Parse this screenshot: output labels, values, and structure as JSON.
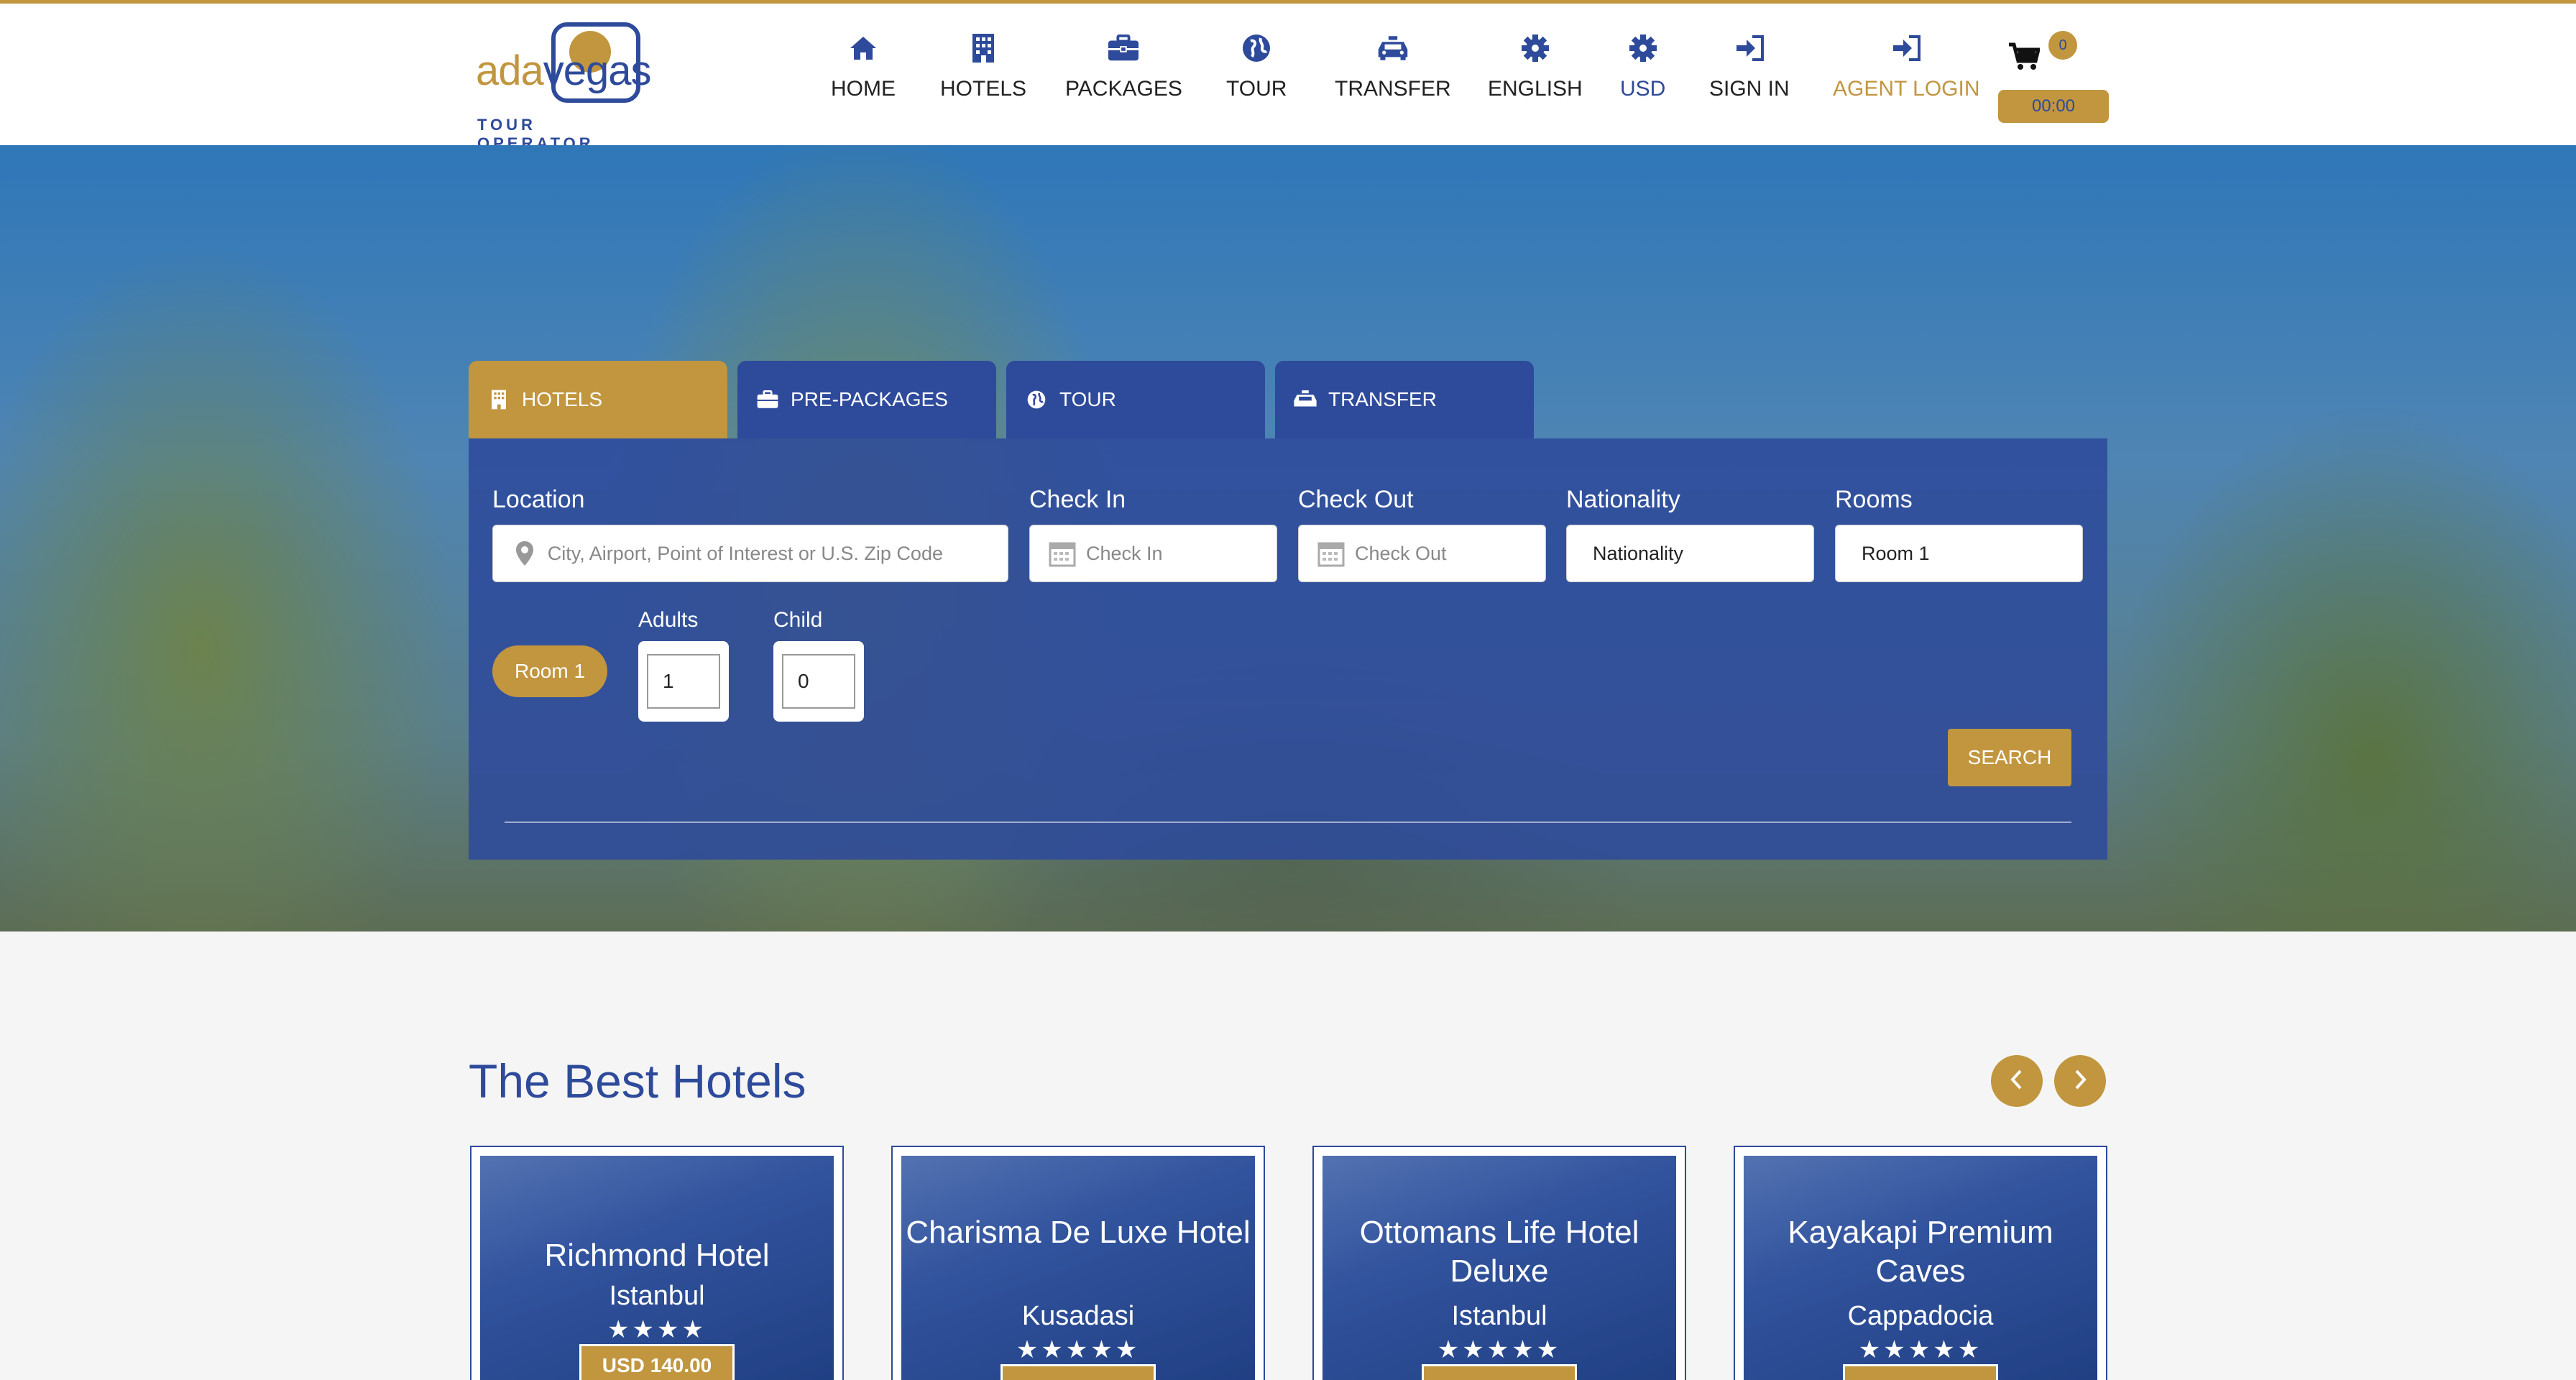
{
  "header": {
    "logo": {
      "word_left": "ada",
      "word_right": "vegas",
      "subtitle": "TOUR OPERATOR"
    },
    "nav": [
      {
        "label": "HOME",
        "icon": "home-icon"
      },
      {
        "label": "HOTELS",
        "icon": "building-icon"
      },
      {
        "label": "PACKAGES",
        "icon": "briefcase-icon"
      },
      {
        "label": "TOUR",
        "icon": "globe-icon"
      },
      {
        "label": "TRANSFER",
        "icon": "taxi-icon"
      },
      {
        "label": "ENGLISH",
        "icon": "gear-icon"
      },
      {
        "label": "USD",
        "icon": "gear-icon"
      },
      {
        "label": "SIGN IN",
        "icon": "sign-in-icon"
      },
      {
        "label": "AGENT LOGIN",
        "icon": "sign-in-icon"
      }
    ],
    "cart": {
      "count": "0",
      "timer": "00:00",
      "icon": "cart-icon"
    }
  },
  "search": {
    "tabs": [
      {
        "label": "HOTELS",
        "icon": "building-icon",
        "active": true
      },
      {
        "label": "PRE-PACKAGES",
        "icon": "briefcase-icon",
        "active": false
      },
      {
        "label": "TOUR",
        "icon": "globe-icon",
        "active": false
      },
      {
        "label": "TRANSFER",
        "icon": "taxi-icon",
        "active": false
      }
    ],
    "location": {
      "label": "Location",
      "placeholder": "City, Airport, Point of Interest or U.S. Zip Code"
    },
    "check_in": {
      "label": "Check In",
      "placeholder": "Check In"
    },
    "check_out": {
      "label": "Check Out",
      "placeholder": "Check Out"
    },
    "nationality": {
      "label": "Nationality",
      "value": "Nationality"
    },
    "rooms": {
      "label": "Rooms",
      "value": "Room 1"
    },
    "room_pill": "Room 1",
    "adults": {
      "label": "Adults",
      "value": "1"
    },
    "child": {
      "label": "Child",
      "value": "0"
    },
    "search_button": "SEARCH"
  },
  "best_hotels": {
    "title": "The Best Hotels",
    "cards": [
      {
        "name": "Richmond Hotel",
        "city": "Istanbul",
        "stars": "★★★★",
        "price": "USD 140.00"
      },
      {
        "name": "Charisma De Luxe Hotel",
        "city": "Kusadasi",
        "stars": "★★★★★",
        "price": ""
      },
      {
        "name": "Ottomans Life Hotel Deluxe",
        "city": "Istanbul",
        "stars": "★★★★★",
        "price": ""
      },
      {
        "name": "Kayakapi Premium Caves",
        "city": "Cappadocia",
        "stars": "★★★★★",
        "price": ""
      }
    ]
  },
  "colors": {
    "gold": "#c1963f",
    "blue": "#2e4a9b"
  }
}
